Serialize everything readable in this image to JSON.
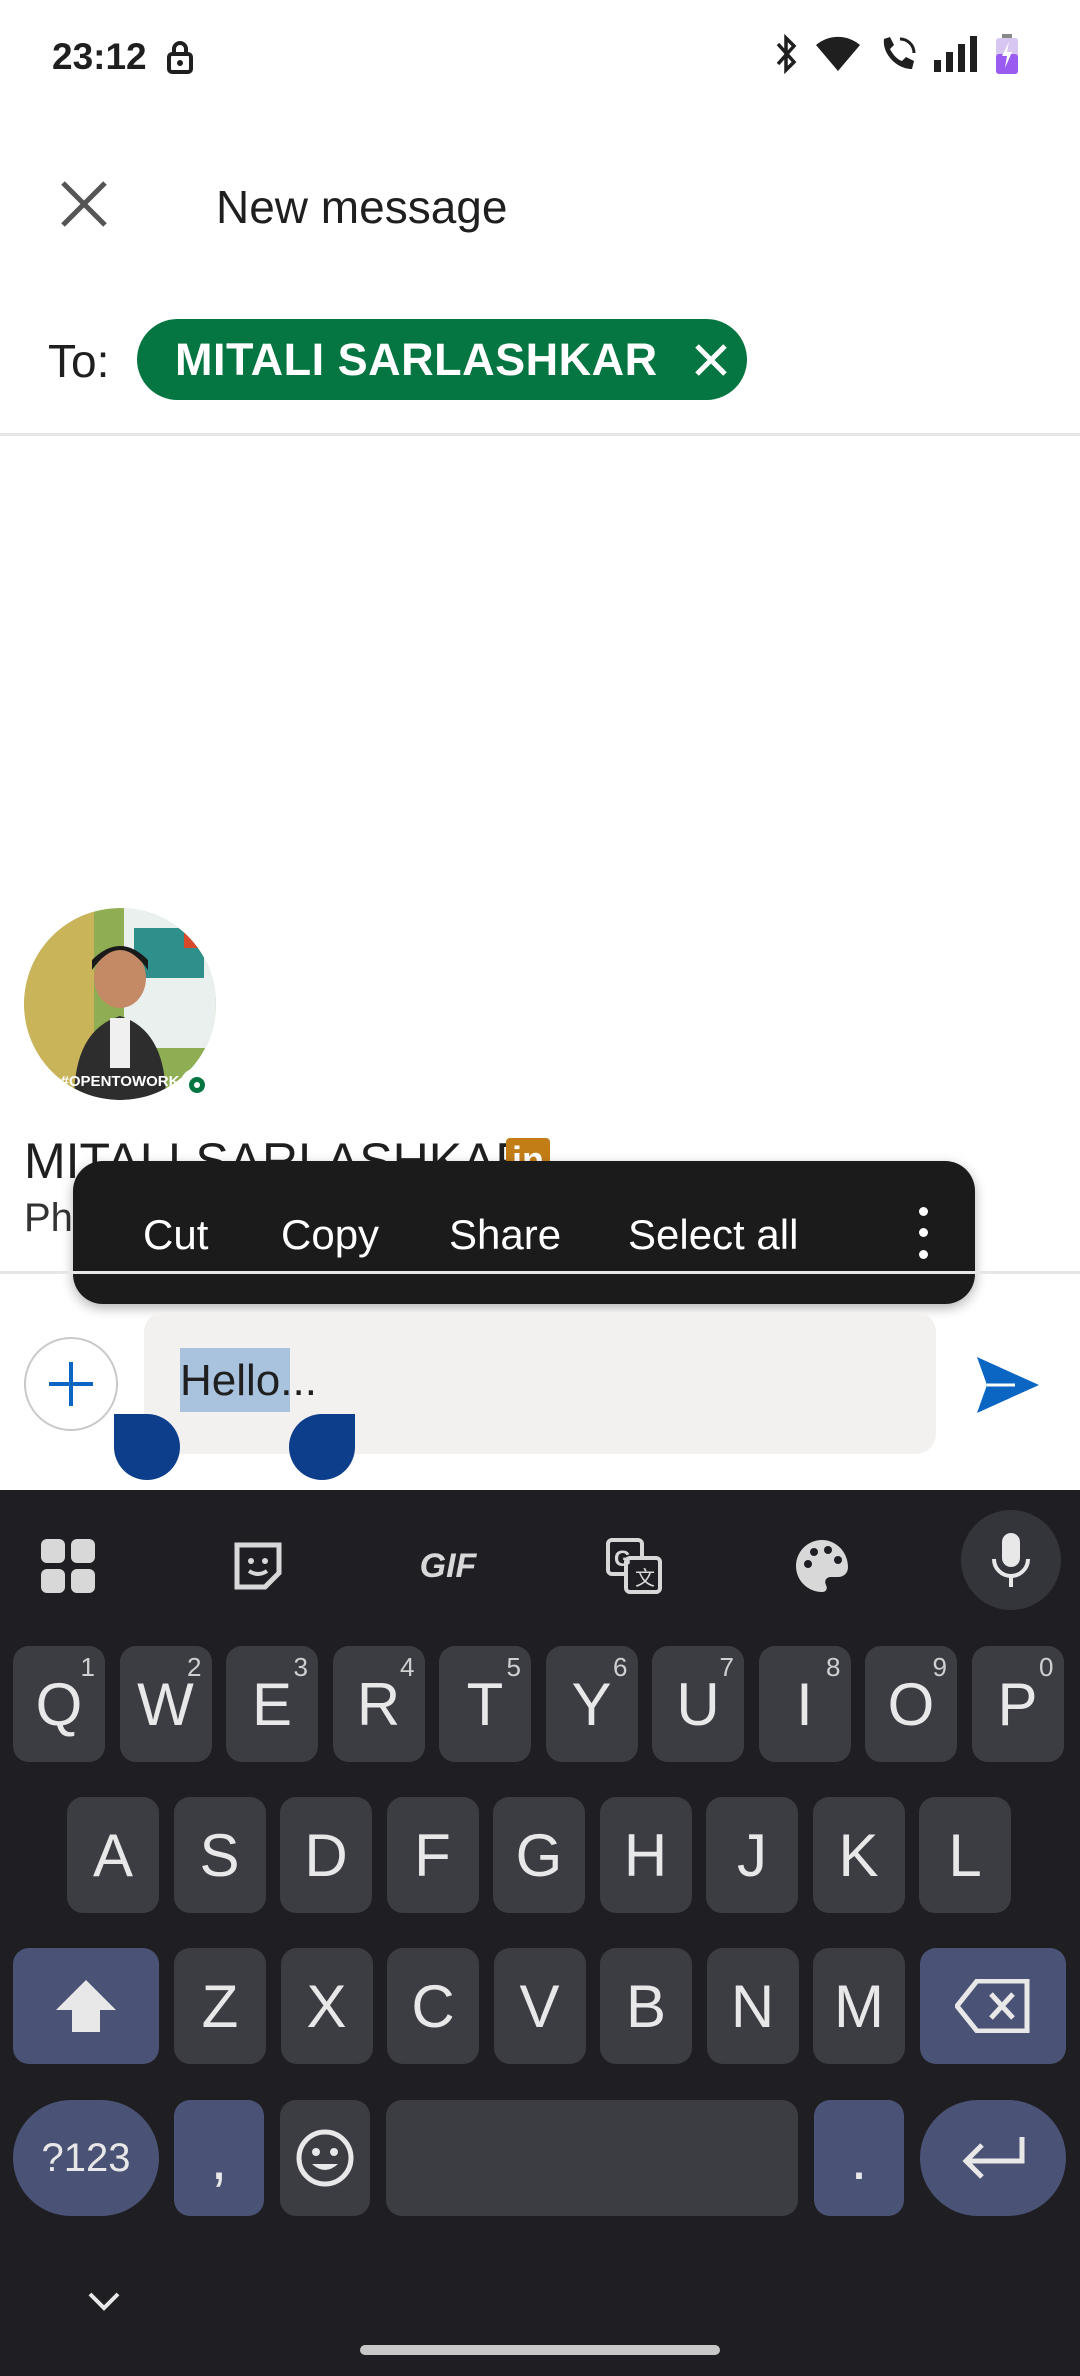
{
  "status_bar": {
    "time": "23:12"
  },
  "header": {
    "title": "New message"
  },
  "to_row": {
    "label": "To:",
    "recipient": "MITALI SARLASHKAR"
  },
  "profile": {
    "name": "MITALI SARLASHKAR",
    "badge": "in",
    "headline": "Ph",
    "avatar_badge_text": "#OPENTOWORK"
  },
  "context_menu": {
    "cut": "Cut",
    "copy": "Copy",
    "share": "Share",
    "select_all": "Select all"
  },
  "compose": {
    "text": "Hello...",
    "selected_text": "Hello"
  },
  "keyboard": {
    "row1": [
      {
        "k": "Q",
        "s": "1"
      },
      {
        "k": "W",
        "s": "2"
      },
      {
        "k": "E",
        "s": "3"
      },
      {
        "k": "R",
        "s": "4"
      },
      {
        "k": "T",
        "s": "5"
      },
      {
        "k": "Y",
        "s": "6"
      },
      {
        "k": "U",
        "s": "7"
      },
      {
        "k": "I",
        "s": "8"
      },
      {
        "k": "O",
        "s": "9"
      },
      {
        "k": "P",
        "s": "0"
      }
    ],
    "row2": [
      "A",
      "S",
      "D",
      "F",
      "G",
      "H",
      "J",
      "K",
      "L"
    ],
    "row3": [
      "Z",
      "X",
      "C",
      "V",
      "B",
      "N",
      "M"
    ],
    "symbols": "?123",
    "comma": ",",
    "period": ".",
    "gif": "GIF"
  },
  "colors": {
    "brand_green": "#057642",
    "send_blue": "#0a66c2",
    "keyboard_bg": "#1f1f23"
  }
}
